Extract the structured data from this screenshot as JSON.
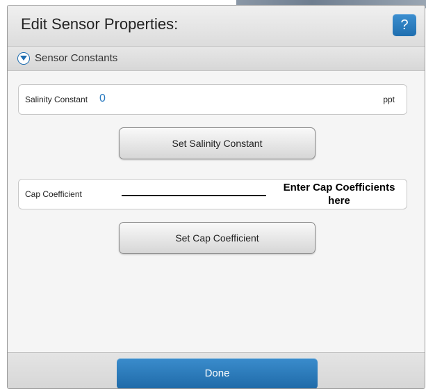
{
  "dialog": {
    "title": "Edit Sensor Properties:",
    "help_label": "?"
  },
  "section": {
    "label": "Sensor Constants"
  },
  "salinity": {
    "label": "Salinity Constant",
    "value": "0",
    "unit": "ppt",
    "button_label": "Set Salinity Constant"
  },
  "cap": {
    "label": "Cap Coefficient",
    "callout": "Enter Cap Coefficients here",
    "button_label": "Set Cap Coefficient"
  },
  "footer": {
    "done_label": "Done"
  },
  "colors": {
    "accent": "#1f6fb0",
    "value_text": "#2a7ac0"
  },
  "icons": {
    "section_toggle": "chevron-down-icon"
  }
}
